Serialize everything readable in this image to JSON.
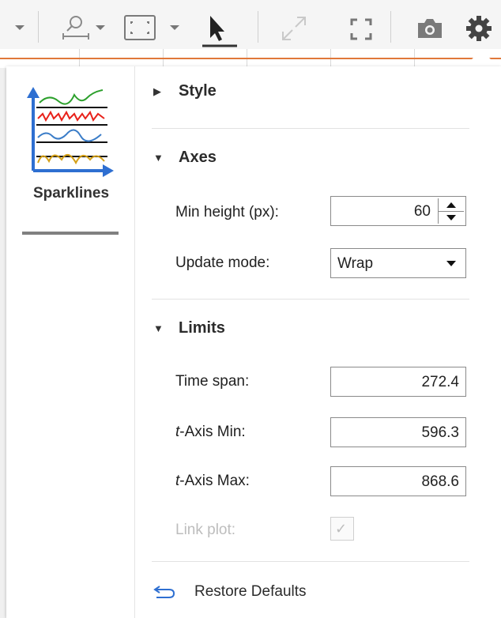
{
  "toolbar": {
    "icons": [
      "chevron-down-icon",
      "zoom-icon",
      "chevron-down-icon",
      "autoscale-icon",
      "chevron-down-icon",
      "pointer-icon",
      "expand-icon",
      "fullscreen-icon",
      "camera-icon",
      "gear-icon"
    ]
  },
  "nav": {
    "sparklines_label": "Sparklines"
  },
  "sections": {
    "style": {
      "title": "Style"
    },
    "axes": {
      "title": "Axes",
      "min_height_label": "Min height (px):",
      "min_height_value": "60",
      "update_mode_label": "Update mode:",
      "update_mode_value": "Wrap"
    },
    "limits": {
      "title": "Limits",
      "time_span_label": "Time span:",
      "time_span_value": "272.4",
      "t_axis_min_label_italic": "t",
      "t_axis_min_label_rest": "-Axis Min:",
      "t_axis_min_value": "596.3",
      "t_axis_max_label_italic": "t",
      "t_axis_max_label_rest": "-Axis Max:",
      "t_axis_max_value": "868.6",
      "link_plot_label": "Link plot:",
      "link_plot_checked": true
    }
  },
  "restore_label": "Restore Defaults",
  "colors": {
    "spark_green": "#2ca02c",
    "spark_red": "#e8221b",
    "spark_blue": "#3b7dc8",
    "spark_yellow": "#d4a017",
    "axis_blue": "#2e6fd1",
    "plot_line_orange": "#e0783a"
  }
}
